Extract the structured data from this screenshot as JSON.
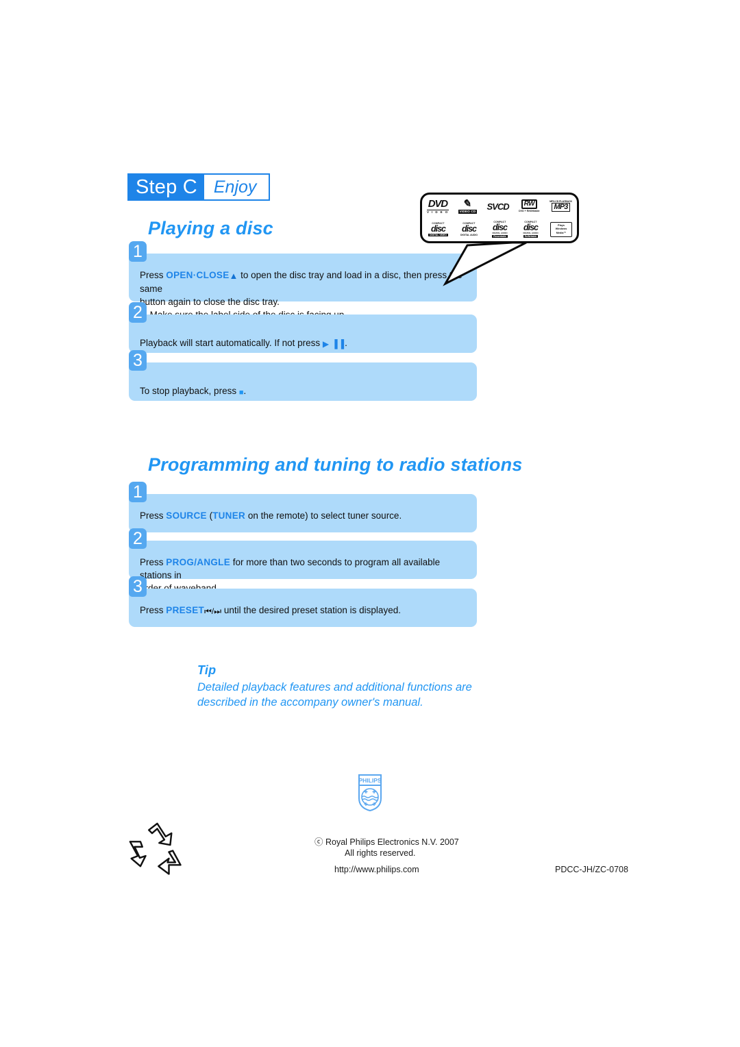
{
  "header": {
    "step_label": "Step C",
    "step_word": "Enjoy"
  },
  "sections": [
    {
      "title": "Playing a disc",
      "steps": [
        {
          "number": "1",
          "line1_prefix": "Press ",
          "keyword": "OPEN·CLOSE",
          "eject_icon": "▲",
          "line1_suffix": " to open the disc tray and load in a disc, then press the same",
          "line2": "button again to close the disc tray.",
          "arrow_icon": "➜",
          "line3": " Make sure the label side of the disc is facing up."
        },
        {
          "number": "2",
          "line1_prefix": "Playback will start automatically. If not press ",
          "play_icon": "▶",
          "pause_icon": "▐▐",
          "line1_suffix": "."
        },
        {
          "number": "3",
          "line1_prefix": "To stop playback, press ",
          "stop_icon": "■",
          "line1_suffix": "."
        }
      ]
    },
    {
      "title": "Programming and tuning to radio stations",
      "steps": [
        {
          "number": "1",
          "line1_prefix": "Press ",
          "keyword": "SOURCE",
          "mid": " (",
          "keyword2": "TUNER",
          "line1_suffix": " on the remote) to select tuner source."
        },
        {
          "number": "2",
          "line1_prefix": "Press ",
          "keyword": "PROG/ANGLE",
          "line1_suffix": " for more than two seconds to program all available stations in",
          "line2": "order of waveband."
        },
        {
          "number": "3",
          "line1_prefix": "Press ",
          "keyword": "PRESET",
          "skip_prev_icon": "⏮",
          "slash": "/",
          "skip_next_icon": "⏭",
          "line1_suffix": " until the desired preset station is displayed."
        }
      ]
    }
  ],
  "logo_callout": {
    "row1": [
      {
        "name": "dvd-video-logo",
        "big": "DVD",
        "sub": "V I D E O"
      },
      {
        "name": "video-cd-logo",
        "mark": "✎",
        "sub": "VIDEO CD"
      },
      {
        "name": "svcd-logo",
        "big": "SVCD"
      },
      {
        "name": "dvd-rewritable-logo",
        "box": "RW",
        "sub": "DVD + ReWritable"
      },
      {
        "name": "mp3-cd-logo",
        "cap": "MP3-CD PLAYBACK",
        "box": "MP3"
      }
    ],
    "row2": [
      {
        "name": "compact-disc-digital-video-logo",
        "cap": "COMPACT",
        "word": "disc",
        "foot": "DIGITAL VIDEO"
      },
      {
        "name": "compact-disc-digital-audio-logo",
        "cap": "COMPACT",
        "word": "disc",
        "foot": "DIGITAL AUDIO",
        "foot_plain": true
      },
      {
        "name": "compact-disc-recordable-logo",
        "cap": "COMPACT",
        "word": "disc",
        "foot2": "DIGITAL AUDIO",
        "foot": "Recordable"
      },
      {
        "name": "compact-disc-rewritable-logo",
        "cap": "COMPACT",
        "word": "disc",
        "foot2": "DIGITAL AUDIO",
        "foot": "ReWritable"
      },
      {
        "name": "plays-windows-media-logo",
        "line1": "Plays",
        "line2": "Windows",
        "line3": "Media™"
      }
    ]
  },
  "tip": {
    "title": "Tip",
    "text": "Detailed playback features and additional functions are described in the accompany owner's manual."
  },
  "brand": {
    "philips_wordmark": "PHILIPS"
  },
  "footer": {
    "copyright": "ⓒ Royal Philips Electronics N.V. 2007",
    "rights": "All rights reserved.",
    "url": "http://www.philips.com",
    "doc_code": "PDCC-JH/ZC-0708"
  },
  "colors": {
    "accent_blue": "#2196F3",
    "header_blue": "#1E84E8",
    "box_blue": "#AEDAFA",
    "badge_blue": "#55A8F0",
    "philips_logo_blue": "#5BA7EF"
  }
}
